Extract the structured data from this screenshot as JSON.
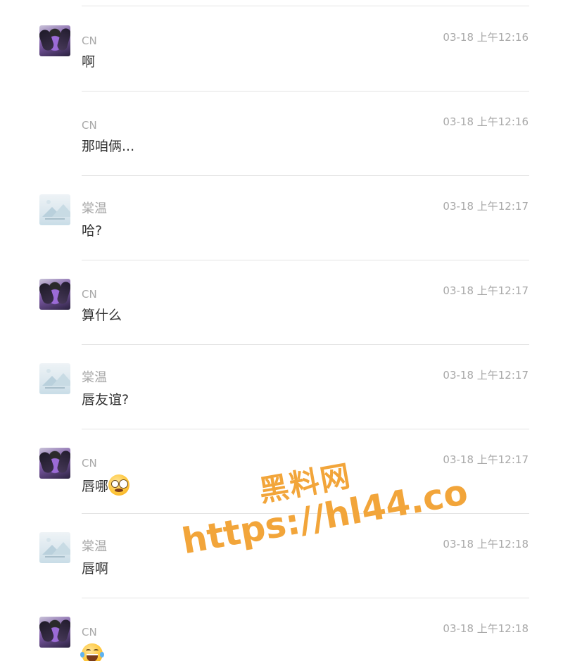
{
  "messages": [
    {
      "sender": "CN",
      "time": "03-18 上午12:16",
      "text": "啊",
      "avatar": "cn",
      "emoji": ""
    },
    {
      "sender": "CN",
      "time": "03-18 上午12:16",
      "text": "那咱俩...",
      "avatar": "",
      "emoji": ""
    },
    {
      "sender": "棠温",
      "time": "03-18 上午12:17",
      "text": "哈?",
      "avatar": "tw",
      "emoji": ""
    },
    {
      "sender": "CN",
      "time": "03-18 上午12:17",
      "text": "算什么",
      "avatar": "cn",
      "emoji": ""
    },
    {
      "sender": "棠温",
      "time": "03-18 上午12:17",
      "text": "唇友谊?",
      "avatar": "tw",
      "emoji": ""
    },
    {
      "sender": "CN",
      "time": "03-18 上午12:17",
      "text": "唇哪",
      "avatar": "cn",
      "emoji": "woozy-face-icon"
    },
    {
      "sender": "棠温",
      "time": "03-18 上午12:18",
      "text": "唇啊",
      "avatar": "tw",
      "emoji": ""
    },
    {
      "sender": "CN",
      "time": "03-18 上午12:18",
      "text": "",
      "avatar": "cn",
      "emoji": "tears-of-joy-icon"
    }
  ],
  "watermark": {
    "title": "黑料网",
    "url": "https://hl44.co",
    "color": "#f2a53a"
  }
}
